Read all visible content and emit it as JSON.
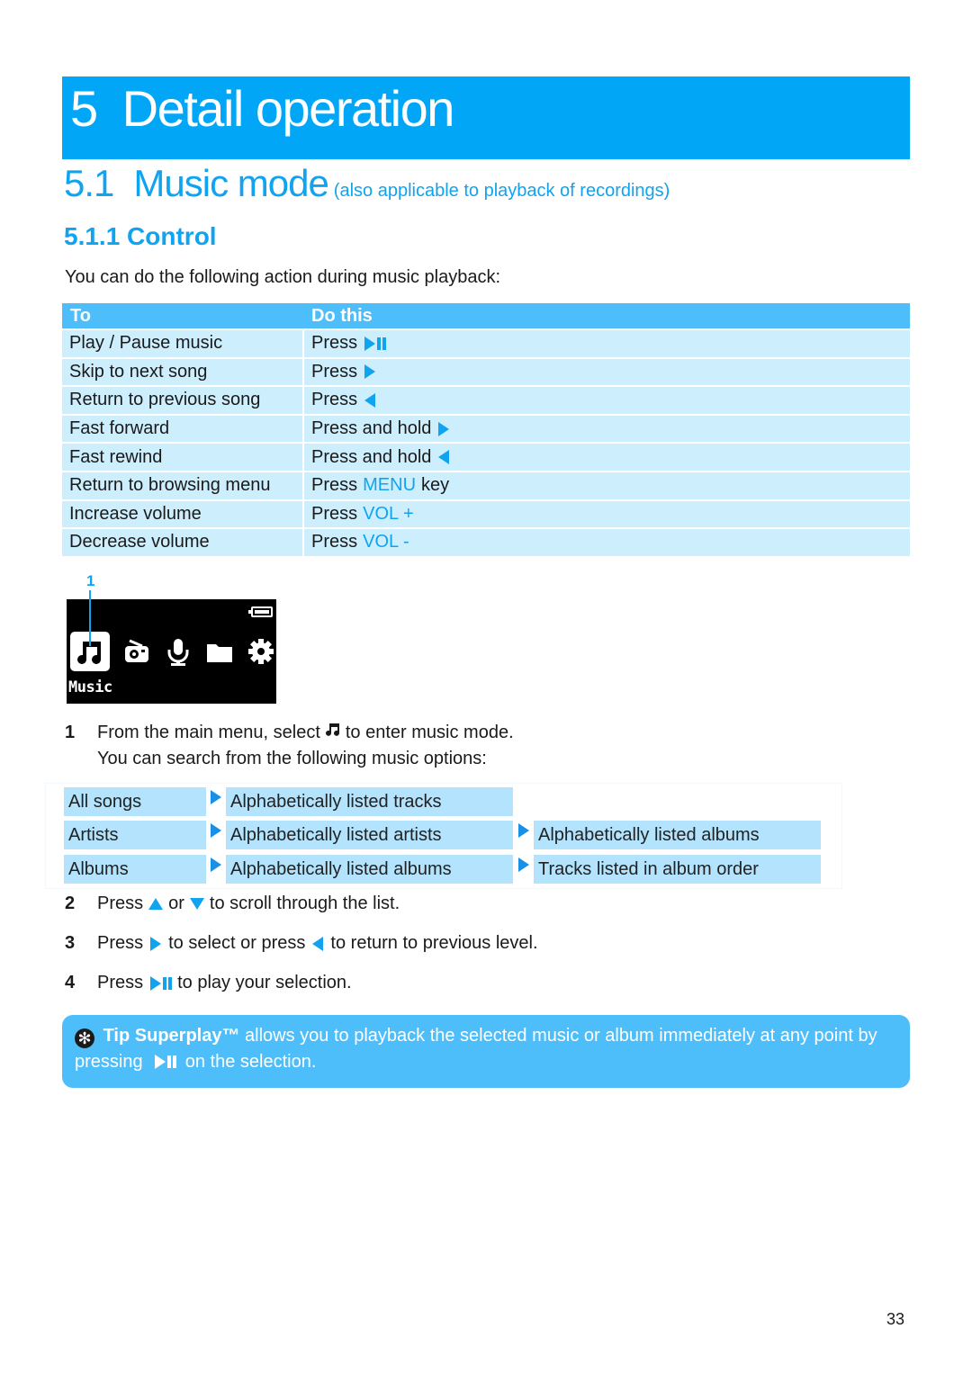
{
  "chapter": {
    "number": "5",
    "title": "Detail operation"
  },
  "section": {
    "number": "5.1",
    "title": "Music mode",
    "subtitle": "(also applicable to playback of recordings)"
  },
  "subsection": {
    "number": "5.1.1",
    "title": "Control",
    "full": "5.1.1 Control"
  },
  "intro": "You can do the following action during music playback:",
  "control_table": {
    "headers": [
      "To",
      "Do this"
    ],
    "rows": [
      {
        "to": "Play / Pause music",
        "action": "Press",
        "highlight": "",
        "icon": "play-pause-icon",
        "suffix": ""
      },
      {
        "to": "Skip to next song",
        "action": "Press",
        "highlight": "",
        "icon": "next-arrow-icon",
        "suffix": ""
      },
      {
        "to": "Return to previous song",
        "action": "Press",
        "highlight": "",
        "icon": "previous-arrow-icon",
        "suffix": ""
      },
      {
        "to": "Fast forward",
        "action": "Press and hold",
        "highlight": "",
        "icon": "next-arrow-icon",
        "suffix": ""
      },
      {
        "to": "Fast rewind",
        "action": "Press and hold",
        "highlight": "",
        "icon": "previous-arrow-icon",
        "suffix": ""
      },
      {
        "to": "Return to browsing menu",
        "action": "Press",
        "highlight": "MENU",
        "icon": "",
        "suffix": "key"
      },
      {
        "to": "Increase volume",
        "action": "Press",
        "highlight": "VOL +",
        "icon": "",
        "suffix": ""
      },
      {
        "to": "Decrease volume",
        "action": "Press",
        "highlight": "VOL -",
        "icon": "",
        "suffix": ""
      }
    ]
  },
  "device_screen": {
    "callout": "1",
    "label": "Music",
    "icons": [
      "music-note-icon",
      "radio-icon",
      "microphone-icon",
      "folder-icon",
      "settings-gear-icon"
    ],
    "battery_icon": "battery-icon"
  },
  "steps": [
    {
      "num": "1",
      "before": "From the main menu, select",
      "after": "to enter music mode.",
      "continuation": "You can search from the following music options:"
    },
    {
      "num": "2",
      "before": "Press",
      "middle": "or",
      "after": "to scroll through the list."
    },
    {
      "num": "3",
      "before": "Press",
      "middle": "to select or press",
      "after": "to return to previous level."
    },
    {
      "num": "4",
      "before": "Press",
      "after": "to play your selection."
    }
  ],
  "music_options": {
    "level1": [
      "All songs",
      "Artists",
      "Albums"
    ],
    "level2": [
      "Alphabetically listed tracks",
      "Alphabetically listed artists",
      "Alphabetically listed albums"
    ],
    "level3": [
      "",
      "Alphabetically listed albums",
      "Tracks listed in album order"
    ]
  },
  "tip": {
    "label": "Tip",
    "product": "Superplay™",
    "text_before": "allows you to playback the selected music or album immediately at any point by pressing",
    "text_after": "on the selection."
  },
  "page_number": "33",
  "colors": {
    "accent": "#02a6f6",
    "header_blue": "#4ebefb",
    "row_blue": "#cdeefd",
    "option_blue": "#b3e3fd",
    "text_blue": "#10a3ef"
  }
}
